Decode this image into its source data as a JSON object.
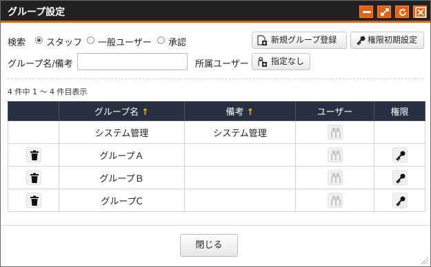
{
  "window": {
    "title": "グループ設定"
  },
  "titlebar_buttons": {
    "minimize": "minimize-icon",
    "maximize": "maximize-icon",
    "refresh": "refresh-icon",
    "close": "close-icon"
  },
  "filter": {
    "label": "検索",
    "options": [
      {
        "label": "スタッフ",
        "selected": true
      },
      {
        "label": "一般ユーザー",
        "selected": false
      },
      {
        "label": "承認",
        "selected": false
      }
    ],
    "name_label": "グループ名/備考",
    "name_value": "",
    "member_label": "所属ユーザー",
    "member_button": "指定なし"
  },
  "actions": {
    "new_group": "新規グループ登録",
    "reset_permissions": "権限初期設定"
  },
  "result_count": "4 件中 1 ～ 4 件目表示",
  "table": {
    "headers": {
      "name": "グループ名",
      "note": "備考",
      "users": "ユーザー",
      "permission": "権限",
      "sort_arrow": "↑"
    },
    "rows": [
      {
        "name": "システム管理",
        "note": "システム管理",
        "deletable": false,
        "has_permission": false
      },
      {
        "name": "グループＡ",
        "note": "",
        "deletable": true,
        "has_permission": true
      },
      {
        "name": "グループＢ",
        "note": "",
        "deletable": true,
        "has_permission": true
      },
      {
        "name": "グループC",
        "note": "",
        "deletable": true,
        "has_permission": true
      }
    ]
  },
  "footer": {
    "close_label": "閉じる"
  },
  "colors": {
    "accent": "#e8600c",
    "header_bg": "#263040",
    "sort_arrow": "#f5b400"
  }
}
